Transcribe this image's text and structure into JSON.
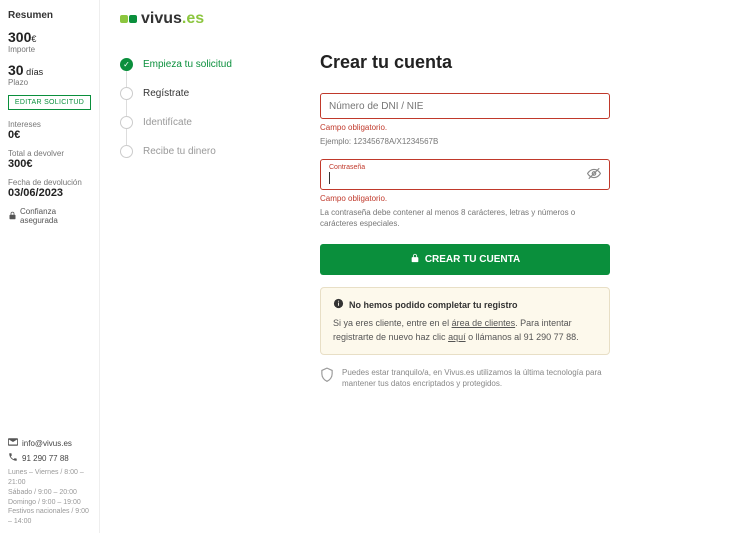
{
  "sidebar": {
    "title": "Resumen",
    "amount_value": "300",
    "amount_unit": "€",
    "amount_label": "Importe",
    "term_value": "30",
    "term_unit": "días",
    "term_label": "Plazo",
    "edit_button": "EDITAR SOLICITUD",
    "interest_label": "Intereses",
    "interest_value": "0€",
    "total_label": "Total a devolver",
    "total_value": "300€",
    "return_date_label": "Fecha de devolución",
    "return_date_value": "03/06/2023",
    "secure_label": "Confianza asegurada",
    "contact_email": "info@vivus.es",
    "contact_phone": "91 290 77 88",
    "hours_1": "Lunes – Viernes / 8:00 – 21:00",
    "hours_2": "Sábado / 9:00 – 20:00",
    "hours_3": "Domingo / 9:00 – 19:00",
    "hours_4": "Festivos nacionales / 9:00 – 14:00"
  },
  "brand": {
    "name": "vivus",
    "tld": ".es"
  },
  "steps": {
    "s1": "Empieza tu solicitud",
    "s2": "Regístrate",
    "s3": "Identifícate",
    "s4": "Recibe tu dinero"
  },
  "form": {
    "heading": "Crear tu cuenta",
    "dni_placeholder": "Número de DNI / NIE",
    "dni_error": "Campo obligatorio.",
    "dni_hint": "Ejemplo: 12345678A/X1234567B",
    "pwd_label": "Contraseña",
    "pwd_error": "Campo obligatorio.",
    "pwd_hint": "La contraseña debe contener al menos 8 carácteres, letras y números o carácteres especiales.",
    "submit": "CREAR TU CUENTA"
  },
  "alert": {
    "title": "No hemos podido completar tu registro",
    "body_1": "Si ya eres cliente, entre en el ",
    "link_1": "área de clientes",
    "body_2": ". Para intentar registrarte de nuevo haz clic ",
    "link_2": "aquí",
    "body_3": " o llámanos al 91 290 77 88."
  },
  "trust": "Puedes estar tranquilo/a, en Vivus.es utilizamos la última tecnología para mantener tus datos encriptados y protegidos."
}
